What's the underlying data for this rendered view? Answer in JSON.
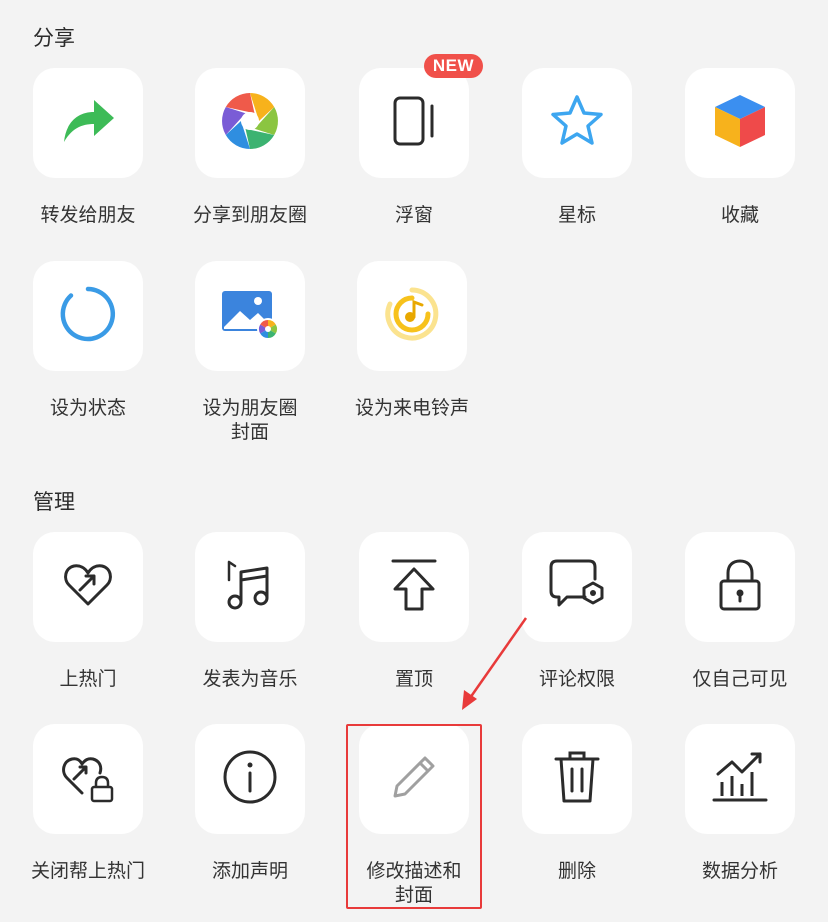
{
  "share_section": {
    "title": "分享",
    "new_badge": "NEW",
    "items": [
      {
        "label": "转发给朋友",
        "icon": "forward-arrow-icon"
      },
      {
        "label": "分享到朋友圈",
        "icon": "moments-aperture-icon"
      },
      {
        "label": "浮窗",
        "icon": "floating-window-icon"
      },
      {
        "label": "星标",
        "icon": "star-icon"
      },
      {
        "label": "收藏",
        "icon": "favorites-cube-icon"
      },
      {
        "label": "设为状态",
        "icon": "status-ring-icon"
      },
      {
        "label": "设为朋友圈\n封面",
        "icon": "moments-cover-image-icon"
      },
      {
        "label": "设为来电铃声",
        "icon": "ringtone-music-icon"
      }
    ]
  },
  "manage_section": {
    "title": "管理",
    "items": [
      {
        "label": "上热门",
        "icon": "heart-trend-icon"
      },
      {
        "label": "发表为音乐",
        "icon": "music-note-icon"
      },
      {
        "label": "置顶",
        "icon": "pin-top-icon"
      },
      {
        "label": "评论权限",
        "icon": "comment-settings-icon"
      },
      {
        "label": "仅自己可见",
        "icon": "lock-icon"
      },
      {
        "label": "关闭帮上热门",
        "icon": "heart-lock-icon"
      },
      {
        "label": "添加声明",
        "icon": "info-icon"
      },
      {
        "label": "修改描述和\n封面",
        "icon": "pencil-icon"
      },
      {
        "label": "删除",
        "icon": "trash-icon"
      },
      {
        "label": "数据分析",
        "icon": "chart-trend-icon"
      }
    ]
  },
  "colors": {
    "background": "#f3f3f3",
    "tile": "#ffffff",
    "badge": "#f0504a",
    "highlight": "#e83a3a"
  }
}
